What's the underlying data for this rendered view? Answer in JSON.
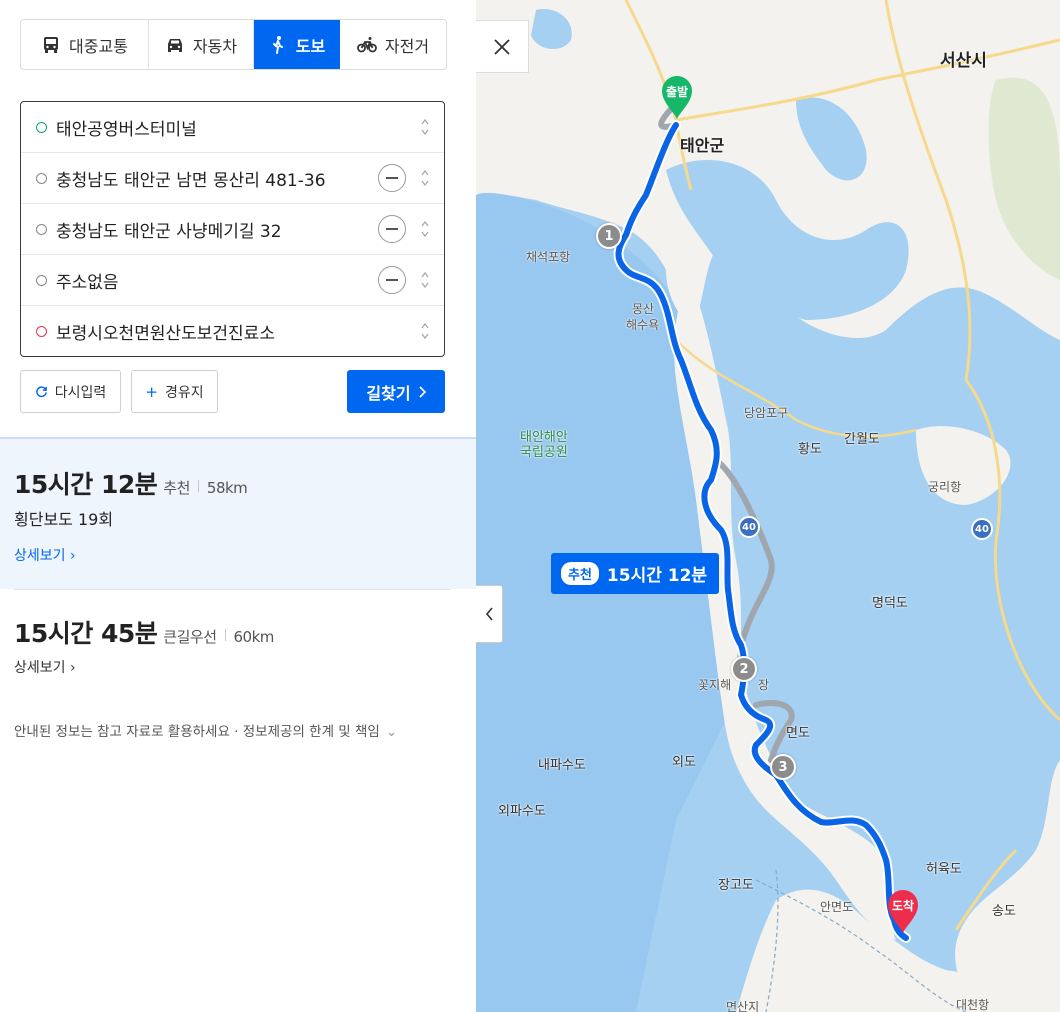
{
  "tabs": [
    {
      "label": "대중교통",
      "icon": "bus-icon"
    },
    {
      "label": "자동차",
      "icon": "car-icon"
    },
    {
      "label": "도보",
      "icon": "walk-icon",
      "active": true
    },
    {
      "label": "자전거",
      "icon": "bicycle-icon"
    }
  ],
  "waypoints": [
    {
      "label": "태안공영버스터미널",
      "type": "start"
    },
    {
      "label": "충청남도 태안군 남면 몽산리 481-36",
      "type": "via"
    },
    {
      "label": "충청남도 태안군 사냥메기길 32",
      "type": "via"
    },
    {
      "label": "주소없음",
      "type": "via"
    },
    {
      "label": "보령시오천면원산도보건진료소",
      "type": "end"
    }
  ],
  "buttons": {
    "reset": "다시입력",
    "add_via": "경유지",
    "search": "길찾기"
  },
  "routes": [
    {
      "time": "15시간 12분",
      "tag": "추천",
      "distance": "58km",
      "crosswalks": "횡단보도 19회",
      "detail": "상세보기"
    },
    {
      "time": "15시간 45분",
      "tag": "큰길우선",
      "distance": "60km",
      "detail": "상세보기"
    }
  ],
  "notice": {
    "text": "안내된 정보는 참고 자료로 활용하세요 · 정보제공의 한계 및 책임"
  },
  "map": {
    "route_badge": {
      "tag": "추천",
      "time": "15시간 12분"
    },
    "start_pin": "출발",
    "end_pin": "도착",
    "steps": [
      "1",
      "2",
      "3"
    ],
    "road_signs": [
      "40",
      "40"
    ],
    "labels": {
      "seosan": "서산시",
      "taean": "태안군",
      "chaeseok": "채석포항",
      "mongsan": "몽산",
      "haesu": "해수욕",
      "dangam": "당암포구",
      "hwangdo": "황도",
      "ganwol": "간월도",
      "gungri": "궁리항",
      "park1": "태안해안",
      "park2": "국립공원",
      "myeongdeok": "명덕도",
      "kkotji": "꽃지해",
      "kkotji2": "장",
      "myeon": "면도",
      "naepa": "내파수도",
      "oedo": "외도",
      "oepa": "외파수도",
      "heoyuk": "허육도",
      "janggo": "장고도",
      "song": "송도",
      "anmyeon": "안면도",
      "myeonsanji": "면산지",
      "daecheon": "대천항"
    },
    "colors": {
      "water": "#a5d0f2",
      "water_deep": "#8fc2ec",
      "land": "#f3f2ee",
      "road": "#f6d98a",
      "route": "#0a64e6",
      "alt_route": "#a0a6ae",
      "start_pin": "#15b769",
      "end_pin": "#ee2d4d"
    }
  }
}
